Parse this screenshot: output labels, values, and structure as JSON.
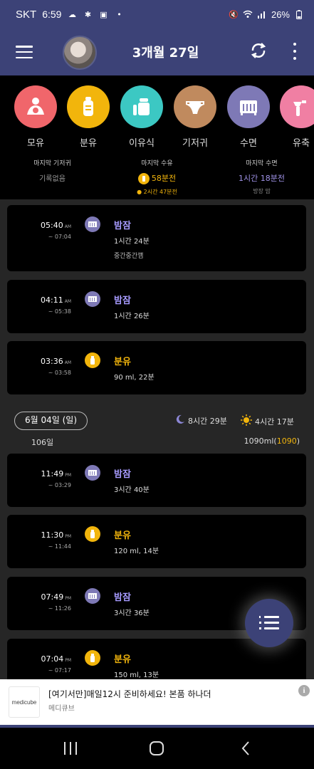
{
  "status_bar": {
    "carrier": "SKT",
    "time": "6:59",
    "battery": "26%"
  },
  "header": {
    "title": "3개월 27일"
  },
  "categories": [
    {
      "label": "모유",
      "color": "#f0666b"
    },
    {
      "label": "분유",
      "color": "#f2b50c"
    },
    {
      "label": "이유식",
      "color": "#3cc8c3"
    },
    {
      "label": "기저귀",
      "color": "#c08a5e"
    },
    {
      "label": "수면",
      "color": "#7e79b6"
    },
    {
      "label": "유축",
      "color": "#f07fa3"
    }
  ],
  "summary": {
    "diaper": {
      "label": "마지막 기저귀",
      "value": "기록없음"
    },
    "feed": {
      "label": "마지막 수유",
      "value": "58분전",
      "sub": "2시간 47분전"
    },
    "sleep": {
      "label": "마지막 수면",
      "value": "1시간 18분전",
      "sub": "방장 맘"
    }
  },
  "records": [
    {
      "time": "05:40",
      "ampm": "AM",
      "end": "~ 07:04",
      "type": "sleep",
      "title": "밤잠",
      "detail": "1시간 24분",
      "note": "중간중간깸"
    },
    {
      "time": "04:11",
      "ampm": "AM",
      "end": "~ 05:38",
      "type": "sleep",
      "title": "밤잠",
      "detail": "1시간 26분",
      "note": ""
    },
    {
      "time": "03:36",
      "ampm": "AM",
      "end": "~ 03:58",
      "type": "formula",
      "title": "분유",
      "detail": "90 ml, 22분",
      "note": ""
    }
  ],
  "day_header": {
    "date": "6월 04일 (일)",
    "day_count": "106일",
    "sleep_total": "8시간 29분",
    "awake_total": "4시간 17분",
    "ml_total": "1090ml",
    "ml_highlight": "1090"
  },
  "records2": [
    {
      "time": "11:49",
      "ampm": "PM",
      "end": "~ 03:29",
      "type": "sleep",
      "title": "밤잠",
      "detail": "3시간 40분"
    },
    {
      "time": "11:30",
      "ampm": "PM",
      "end": "~ 11:44",
      "type": "formula",
      "title": "분유",
      "detail": "120 ml, 14분"
    },
    {
      "time": "07:49",
      "ampm": "PM",
      "end": "~ 11:26",
      "type": "sleep",
      "title": "밤잠",
      "detail": "3시간 36분"
    },
    {
      "time": "07:04",
      "ampm": "PM",
      "end": "~ 07:17",
      "type": "formula",
      "title": "분유",
      "detail": "150 ml, 13분"
    }
  ],
  "ad": {
    "logo": "medicube",
    "title": "[여기서만]매일12시 준비하세요! 본품 하나더",
    "subtitle": "메디큐브"
  }
}
